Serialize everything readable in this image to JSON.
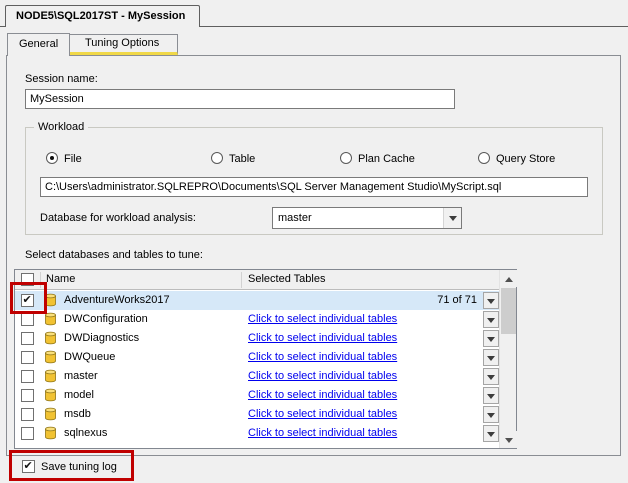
{
  "window": {
    "session_tab_title": "NODE5\\SQL2017ST - MySession"
  },
  "tabs": {
    "general": "General",
    "tuning_options": "Tuning Options",
    "active_tab": "General"
  },
  "session": {
    "label": "Session name:",
    "value": "MySession"
  },
  "workload": {
    "group_label": "Workload",
    "radio_file": "File",
    "radio_table": "Table",
    "radio_plan_cache": "Plan Cache",
    "radio_query_store": "Query Store",
    "selected_radio": "File",
    "file_path": "C:\\Users\\administrator.SQLREPRO\\Documents\\SQL Server Management Studio\\MyScript.sql",
    "database_label": "Database for workload analysis:",
    "database_value": "master"
  },
  "tune": {
    "section_label": "Select databases and tables to tune:",
    "col_name": "Name",
    "col_selected_tables": "Selected Tables",
    "rows": [
      {
        "name": "AdventureWorks2017",
        "selected_tables": "71 of 71",
        "checked": true,
        "selected": true,
        "link": false
      },
      {
        "name": "DWConfiguration",
        "selected_tables": "Click to select individual tables",
        "checked": false,
        "selected": false,
        "link": true
      },
      {
        "name": "DWDiagnostics",
        "selected_tables": "Click to select individual tables",
        "checked": false,
        "selected": false,
        "link": true
      },
      {
        "name": "DWQueue",
        "selected_tables": "Click to select individual tables",
        "checked": false,
        "selected": false,
        "link": true
      },
      {
        "name": "master",
        "selected_tables": "Click to select individual tables",
        "checked": false,
        "selected": false,
        "link": true
      },
      {
        "name": "model",
        "selected_tables": "Click to select individual tables",
        "checked": false,
        "selected": false,
        "link": true
      },
      {
        "name": "msdb",
        "selected_tables": "Click to select individual tables",
        "checked": false,
        "selected": false,
        "link": true
      },
      {
        "name": "sqlnexus",
        "selected_tables": "Click to select individual tables",
        "checked": false,
        "selected": false,
        "link": true
      }
    ]
  },
  "footer": {
    "save_tuning_log_label": "Save tuning log",
    "checked": true
  },
  "colors": {
    "selected_row": "#d6e8f8",
    "link": "#0000ee",
    "tab_accent": "#f0d848",
    "annotation_red": "#c00000"
  }
}
